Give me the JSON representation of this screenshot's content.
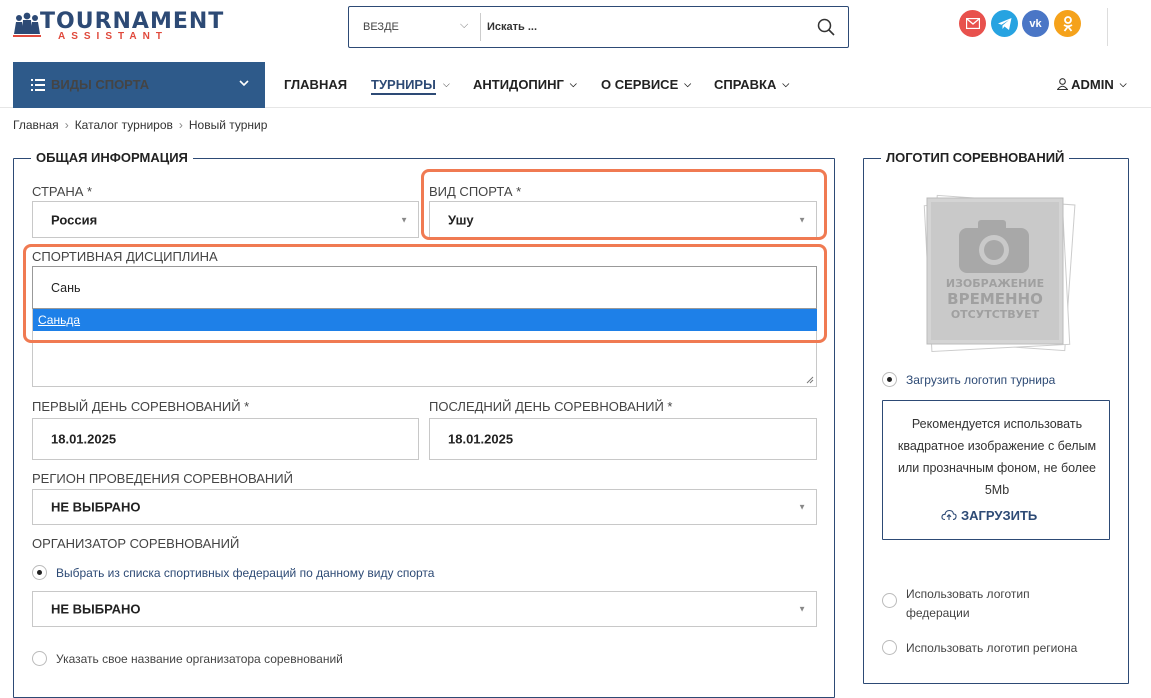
{
  "header": {
    "logo_line1": "TOURNAMENT",
    "logo_line2": "ASSISTANT",
    "search_scope": "ВЕЗДЕ",
    "search_placeholder": "Искать ...",
    "social": [
      {
        "icon": "mail-icon",
        "color": "#e8514d"
      },
      {
        "icon": "telegram-icon",
        "color": "#27a3e1"
      },
      {
        "icon": "vk-icon",
        "color": "#4a76c6"
      },
      {
        "icon": "odnoklassniki-icon",
        "color": "#f5a21b"
      }
    ]
  },
  "nav": {
    "sports_button": "ВИДЫ СПОРТА",
    "items": [
      {
        "label": "ГЛАВНАЯ"
      },
      {
        "label": "ТУРНИРЫ"
      },
      {
        "label": "АНТИДОПИНГ"
      },
      {
        "label": "О СЕРВИСЕ"
      },
      {
        "label": "СПРАВКА"
      }
    ],
    "user": "ADMIN"
  },
  "breadcrumbs": [
    "Главная",
    "Каталог турниров",
    "Новый турнир"
  ],
  "general": {
    "title": "ОБЩАЯ ИНФОРМАЦИЯ",
    "country_label": "СТРАНА *",
    "country_value": "Россия",
    "sport_label": "ВИД СПОРТА *",
    "sport_value": "Ушу",
    "discipline_label": "СПОРТИВНАЯ ДИСЦИПЛИНА",
    "discipline_input": "Сань",
    "discipline_option": "Саньда",
    "first_day_label": "ПЕРВЫЙ ДЕНЬ СОРЕВНОВАНИЙ *",
    "first_day_value": "18.01.2025",
    "last_day_label": "ПОСЛЕДНИЙ ДЕНЬ СОРЕВНОВАНИЙ *",
    "last_day_value": "18.01.2025",
    "region_label": "РЕГИОН ПРОВЕДЕНИЯ СОРЕВНОВАНИЙ",
    "region_value": "НЕ ВЫБРАНО",
    "organizer_label": "ОРГАНИЗАТОР СОРЕВНОВАНИЙ",
    "organizer_option1": "Выбрать из списка спортивных федераций по данному виду спорта",
    "organizer_value": "НЕ ВЫБРАНО",
    "organizer_option2": "Указать свое название организатора соревнований"
  },
  "logo_panel": {
    "title": "ЛОГОТИП СОРЕВНОВАНИЙ",
    "placeholder_l1": "ИЗОБРАЖЕНИЕ",
    "placeholder_l2": "ВРЕМЕННО",
    "placeholder_l3": "ОТСУТСТВУЕТ",
    "upload_option": "Загрузить логотип турнира",
    "upload_hint": "Рекомендуется использовать квадратное изображение с белым или прозначным фоном, не более 5Mb",
    "upload_button": "ЗАГРУЗИТЬ",
    "federation_option": "Использовать логотип федерации",
    "region_option": "Использовать логотип региона"
  },
  "colors": {
    "brand": "#2d4a75",
    "accent": "#e0493c",
    "highlight": "#f07a52",
    "selection": "#1e80e8"
  }
}
